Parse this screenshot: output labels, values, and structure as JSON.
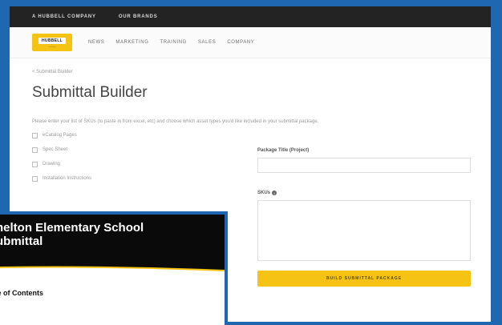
{
  "topbar": {
    "items": [
      "A HUBBELL COMPANY",
      "OUR BRANDS"
    ]
  },
  "logo": {
    "text": "HUBBELL"
  },
  "nav": {
    "items": [
      "NEWS",
      "MARKETING",
      "TRAINING",
      "SALES",
      "COMPANY"
    ]
  },
  "breadcrumb": "< Submittal Builder",
  "page_title": "Submittal Builder",
  "instructions": "Please enter your list of SKUs (to paste in from excel, etc) and choose which asset types you'd like included in your submittal package.",
  "documents": [
    {
      "label": "eCatalog Pages"
    },
    {
      "label": "Spec Sheet"
    },
    {
      "label": "Drawing"
    },
    {
      "label": "Installation Instructions"
    }
  ],
  "form": {
    "package_title_label": "Package Title (Project)",
    "skus_label": "SKUs",
    "build_button": "BUILD SUBMITTAL PACKAGE"
  },
  "doc_preview": {
    "title_line1": "helton Elementary School",
    "title_line2": "ubmittal",
    "toc": "le of Contents"
  },
  "colors": {
    "frame": "#1f67b0",
    "accent": "#f4c313",
    "topbar": "#232323"
  }
}
